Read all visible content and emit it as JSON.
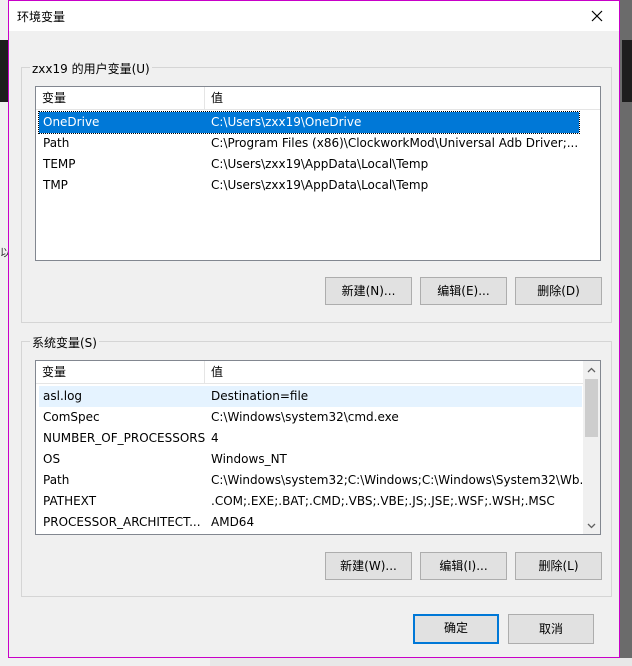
{
  "dialog": {
    "title": "环境变量",
    "ok_label": "确定",
    "cancel_label": "取消"
  },
  "user_vars": {
    "group_label": "zxx19 的用户变量(U)",
    "col_var": "变量",
    "col_value": "值",
    "rows": [
      {
        "name": "OneDrive",
        "value": "C:\\Users\\zxx19\\OneDrive"
      },
      {
        "name": "Path",
        "value": "C:\\Program Files (x86)\\ClockworkMod\\Universal Adb Driver;..."
      },
      {
        "name": "TEMP",
        "value": "C:\\Users\\zxx19\\AppData\\Local\\Temp"
      },
      {
        "name": "TMP",
        "value": "C:\\Users\\zxx19\\AppData\\Local\\Temp"
      }
    ],
    "new_label": "新建(N)...",
    "edit_label": "编辑(E)...",
    "delete_label": "删除(D)"
  },
  "system_vars": {
    "group_label": "系统变量(S)",
    "col_var": "变量",
    "col_value": "值",
    "rows": [
      {
        "name": "asl.log",
        "value": "Destination=file"
      },
      {
        "name": "ComSpec",
        "value": "C:\\Windows\\system32\\cmd.exe"
      },
      {
        "name": "NUMBER_OF_PROCESSORS",
        "value": "4"
      },
      {
        "name": "OS",
        "value": "Windows_NT"
      },
      {
        "name": "Path",
        "value": "C:\\Windows\\system32;C:\\Windows;C:\\Windows\\System32\\Wb..."
      },
      {
        "name": "PATHEXT",
        "value": ".COM;.EXE;.BAT;.CMD;.VBS;.VBE;.JS;.JSE;.WSF;.WSH;.MSC"
      },
      {
        "name": "PROCESSOR_ARCHITECT...",
        "value": "AMD64"
      }
    ],
    "new_label": "新建(W)...",
    "edit_label": "编辑(I)...",
    "delete_label": "删除(L)"
  },
  "background": {
    "partial_char": "以"
  }
}
